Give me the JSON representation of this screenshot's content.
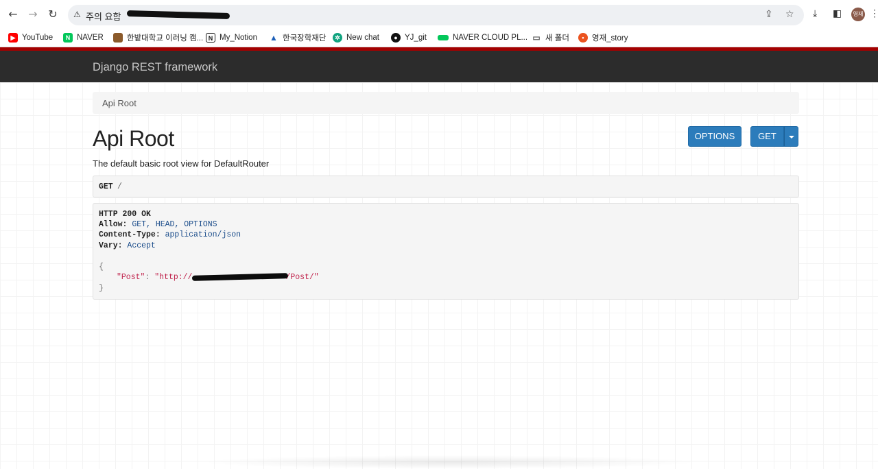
{
  "browser": {
    "security_label": "주의 요함",
    "bookmarks": [
      {
        "label": "YouTube",
        "icon": "youtube-icon",
        "color": "#ff0000"
      },
      {
        "label": "NAVER",
        "icon": "naver-icon",
        "color": "#03c75a"
      },
      {
        "label": "한밭대학교 이러닝 캠...",
        "icon": "book-icon",
        "color": "#8b5a2b"
      },
      {
        "label": "My_Notion",
        "icon": "notion-icon",
        "color": "#111111"
      },
      {
        "label": "한국장학재단",
        "icon": "graduation-icon",
        "color": "#1d5fb8"
      },
      {
        "label": "New chat",
        "icon": "chatgpt-icon",
        "color": "#10a37f"
      },
      {
        "label": "YJ_git",
        "icon": "github-icon",
        "color": "#111111"
      },
      {
        "label": "NAVER CLOUD PL...",
        "icon": "naver-cloud-icon",
        "color": "#03c75a"
      },
      {
        "label": "새 폴더",
        "icon": "folder-icon",
        "color": "#777777"
      },
      {
        "label": "영재_story",
        "icon": "tistory-icon",
        "color": "#eb531f"
      }
    ],
    "avatar_text": "영재"
  },
  "navbar": {
    "brand": "Django REST framework"
  },
  "breadcrumb": {
    "label": "Api Root"
  },
  "page": {
    "title": "Api Root",
    "description": "The default basic root view for DefaultRouter",
    "buttons": {
      "options": "OPTIONS",
      "get": "GET"
    }
  },
  "request": {
    "method": "GET",
    "path": "/"
  },
  "response": {
    "status": "HTTP 200 OK",
    "headers": [
      {
        "name": "Allow:",
        "value": "GET, HEAD, OPTIONS"
      },
      {
        "name": "Content-Type:",
        "value": "application/json"
      },
      {
        "name": "Vary:",
        "value": "Accept"
      }
    ],
    "body": {
      "open": "{",
      "key": "\"Post\"",
      "colon": ":",
      "value_prefix": "\"http://",
      "value_suffix": "/Post/\"",
      "close": "}"
    }
  },
  "colors": {
    "navbar": "#2c2c2c",
    "accent_red": "#a30000",
    "button_blue": "#2c7cbb"
  }
}
